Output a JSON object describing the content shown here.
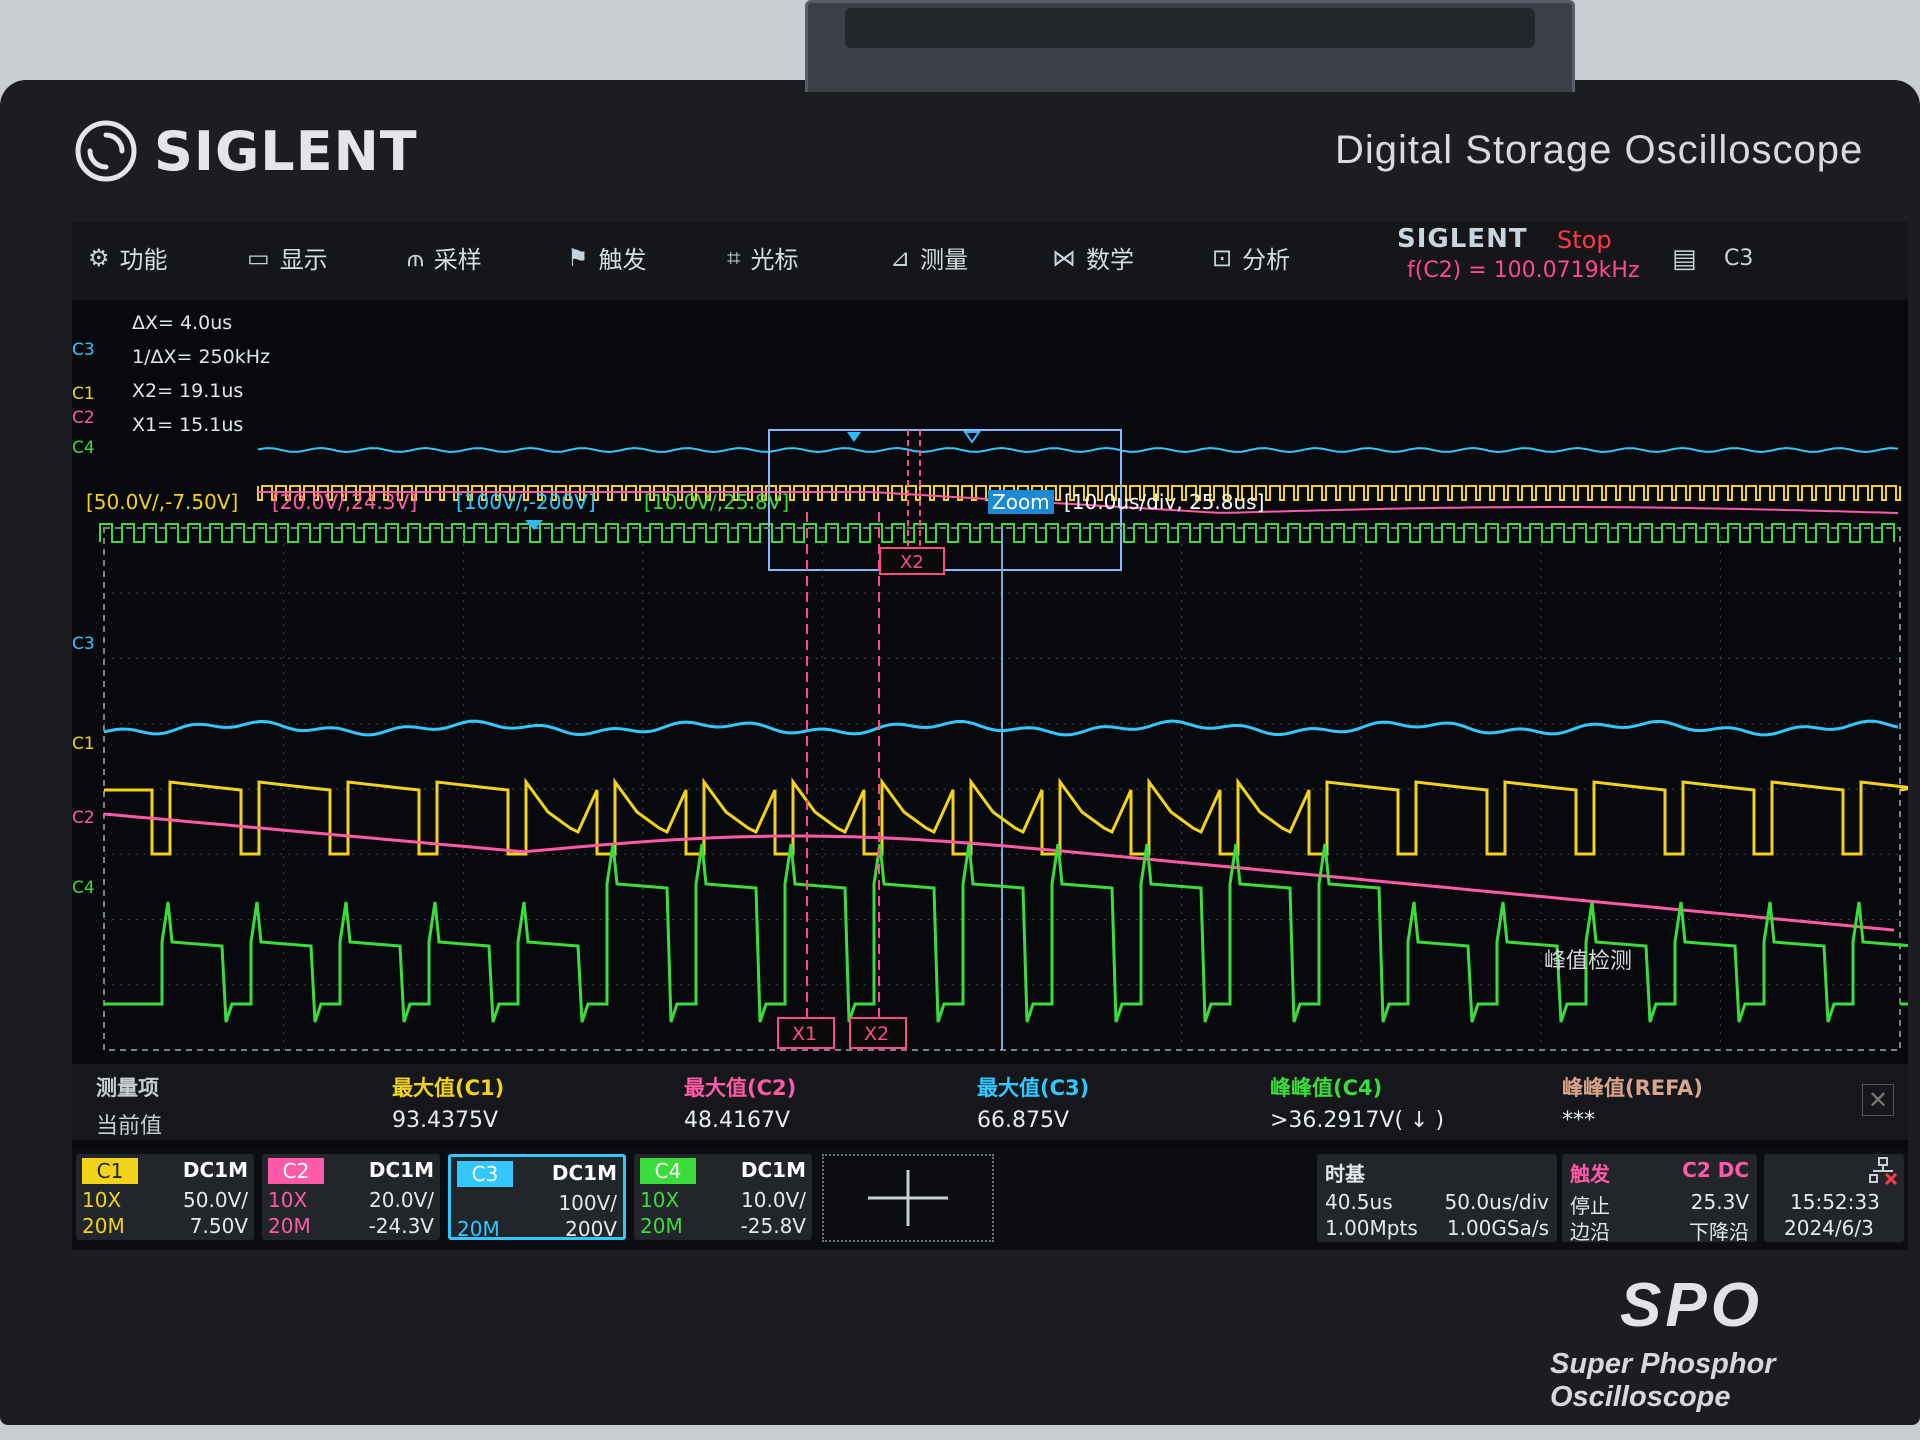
{
  "device": {
    "brand": "SIGLENT",
    "model": "Digital Storage Oscilloscope",
    "series_logo": "SPO",
    "series_name": "Super Phosphor Oscilloscope"
  },
  "menu": {
    "items": [
      {
        "icon": "gear-icon",
        "label": "功能"
      },
      {
        "icon": "display-icon",
        "label": "显示"
      },
      {
        "icon": "acquire-icon",
        "label": "采样"
      },
      {
        "icon": "flag-icon",
        "label": "触发"
      },
      {
        "icon": "cursor-icon",
        "label": "光标"
      },
      {
        "icon": "measure-icon",
        "label": "测量"
      },
      {
        "icon": "math-icon",
        "label": "数学"
      },
      {
        "icon": "analysis-icon",
        "label": "分析"
      }
    ],
    "logo": "SIGLENT",
    "run_state": "Stop",
    "freq_counter": "f(C2) = 100.0719kHz",
    "trigger_source": "C3"
  },
  "cursor_info": {
    "dx": "ΔX= 4.0us",
    "inv_dx": "1/ΔX= 250kHz",
    "x2": "X2= 19.1us",
    "x1": "X1= 15.1us"
  },
  "channel_markers": {
    "c3": "C3",
    "c1": "C1",
    "c2": "C2",
    "c4": "C4"
  },
  "scales": {
    "c1": "[50.0V/,-7.50V]",
    "c2": "[20.0V/,24.3V]",
    "c3": "[100V/,-200V]",
    "c4": "[10.0V/,25.8V]",
    "zoom_label": "Zoom",
    "zoom_value": "[10.0us/div, 25.8us]"
  },
  "cursors": {
    "x1_label": "X1",
    "x2_label": "X2"
  },
  "annotation": "峰值检测",
  "measurements": {
    "header_label": "测量项",
    "value_label": "当前值",
    "items": [
      {
        "name": "最大值(C1)",
        "value": "93.4375V",
        "color": "#f2d31a"
      },
      {
        "name": "最大值(C2)",
        "value": "48.4167V",
        "color": "#ff5aa8"
      },
      {
        "name": "最大值(C3)",
        "value": "66.875V",
        "color": "#32c8ff"
      },
      {
        "name": "峰峰值(C4)",
        "value": ">36.2917V( ↓ )",
        "color": "#3cdc3c"
      },
      {
        "name": "峰峰值(REFA)",
        "value": "***",
        "color": "#d9a68c"
      }
    ]
  },
  "channels": [
    {
      "id": "C1",
      "coupling": "DC1M",
      "probe": "10X",
      "bw": "20M",
      "vdiv": "50.0V/",
      "offset": "7.50V",
      "color": "#f2d31a"
    },
    {
      "id": "C2",
      "coupling": "DC1M",
      "probe": "10X",
      "bw": "20M",
      "vdiv": "20.0V/",
      "offset": "-24.3V",
      "color": "#ff5aa8"
    },
    {
      "id": "C3",
      "coupling": "DC1M",
      "probe": "",
      "bw": "20M",
      "vdiv": "100V/",
      "offset": "200V",
      "color": "#32c8ff"
    },
    {
      "id": "C4",
      "coupling": "DC1M",
      "probe": "10X",
      "bw": "20M",
      "vdiv": "10.0V/",
      "offset": "-25.8V",
      "color": "#3cdc3c"
    }
  ],
  "timebase": {
    "title": "时基",
    "delay": "40.5us",
    "tdiv": "50.0us/div",
    "mem": "1.00Mpts",
    "srate": "1.00GSa/s"
  },
  "trigger": {
    "title": "触发",
    "src": "C2 DC",
    "mode": "停止",
    "level": "25.3V",
    "type": "边沿",
    "slope": "下降沿"
  },
  "clock": {
    "time": "15:52:33",
    "date": "2024/6/3"
  }
}
